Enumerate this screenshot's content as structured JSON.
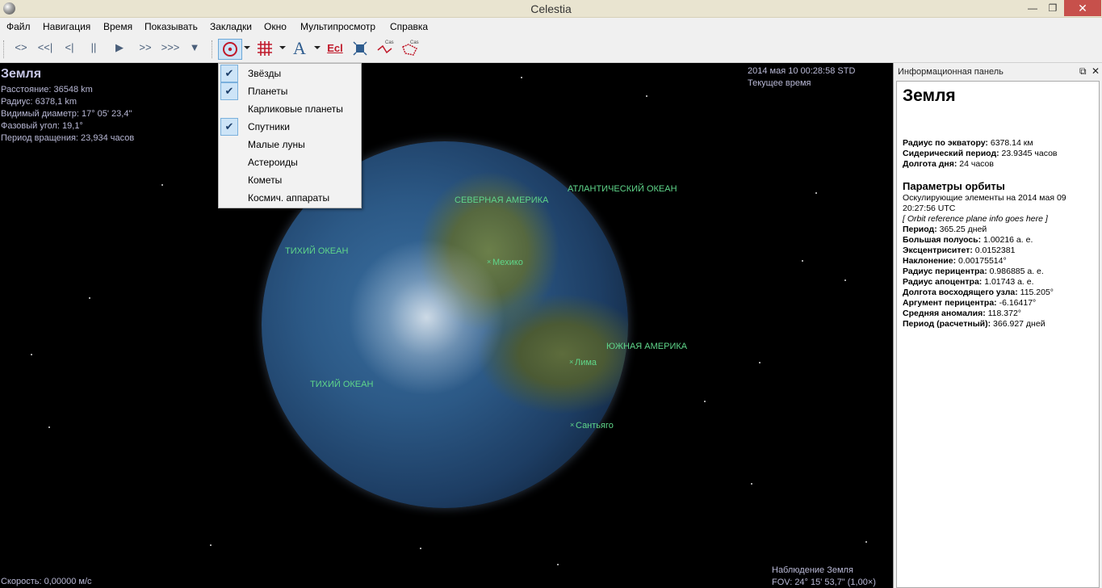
{
  "window": {
    "title": "Celestia",
    "minimize": "—",
    "maximize": "❐",
    "close": "✕"
  },
  "menu": [
    "Файл",
    "Навигация",
    "Время",
    "Показывать",
    "Закладки",
    "Окно",
    "Мультипросмотр",
    "Справка"
  ],
  "toolbar": {
    "reverse": "<>",
    "rewind_fast": "<<|",
    "step_back": "<|",
    "pause": "||",
    "play": "▶",
    "forward": ">>",
    "forward_fast": ">>>",
    "filter": "▼",
    "labels_icon": "A",
    "ecliptic": "Ecl",
    "cas1": "Cas",
    "cas2": "Cas"
  },
  "dropdown": {
    "items": [
      {
        "label": "Звёзды",
        "checked": true
      },
      {
        "label": "Планеты",
        "checked": true
      },
      {
        "label": "Карликовые планеты",
        "checked": false
      },
      {
        "label": "Спутники",
        "checked": true
      },
      {
        "label": "Малые луны",
        "checked": false
      },
      {
        "label": "Астероиды",
        "checked": false
      },
      {
        "label": "Кометы",
        "checked": false
      },
      {
        "label": "Космич. аппараты",
        "checked": false
      }
    ],
    "check_glyph": "✔"
  },
  "hud": {
    "object_name": "Земля",
    "distance": "Расстояние: 36548 km",
    "radius": "Радиус: 6378,1 km",
    "apparent_diameter": "Видимый диаметр: 17° 05' 23,4\"",
    "phase_angle": "Фазовый угол: 19,1°",
    "rotation_period": "Период вращения: 23,934 часов",
    "datetime": "2014 мая 10 00:28:58 STD",
    "time_mode": "Текущее время",
    "speed": "Скорость: 0,00000 м/с",
    "tracking": "Наблюдение Земля",
    "fov": "FOV: 24° 15' 53,7\" (1,00×)"
  },
  "labels": {
    "north_america": "СЕВЕРНАЯ АМЕРИКА",
    "atlantic": "АТЛАНТИЧЕСКИЙ ОКЕАН",
    "pacific1": "ТИХИЙ ОКЕАН",
    "mexico": "Мехико",
    "south_america": "ЮЖНАЯ АМЕРИКА",
    "lima": "Лима",
    "pacific2": "ТИХИЙ ОКЕАН",
    "santiago": "Сантьяго"
  },
  "panel": {
    "title": "Информационная панель",
    "restore": "⧉",
    "close": "✕",
    "heading": "Земля",
    "equator_radius_label": "Радиус по экватору:",
    "equator_radius": " 6378.14 км",
    "sidereal_label": "Сидерический период:",
    "sidereal": " 23.9345 часов",
    "day_label": "Долгота дня:",
    "day": " 24 часов",
    "orbit_heading": "Параметры орбиты",
    "osc_line1": "Оскулирующие элементы на 2014 мая 09",
    "osc_line2": "20:27:56 UTC",
    "ref_plane": "[ Orbit reference plane info goes here ]",
    "period_label": "Период:",
    "period": " 365.25 дней",
    "semimajor_label": "Большая полуось:",
    "semimajor": " 1.00216 а. е.",
    "ecc_label": "Эксцентриситет:",
    "ecc": " 0.0152381",
    "incl_label": "Наклонение:",
    "incl": " 0.00175514°",
    "peri_label": "Радиус перицентра:",
    "peri": " 0.986885 а. е.",
    "apo_label": "Радиус апоцентра:",
    "apo": " 1.01743 а. е.",
    "node_label": "Долгота восходящего узла:",
    "node": " 115.205°",
    "argp_label": "Аргумент перицентра:",
    "argp": " -6.16417°",
    "mean_anom_label": "Средняя аномалия:",
    "mean_anom": " 118.372°",
    "calc_period_label": "Период (расчетный):",
    "calc_period": " 366.927 дней"
  }
}
